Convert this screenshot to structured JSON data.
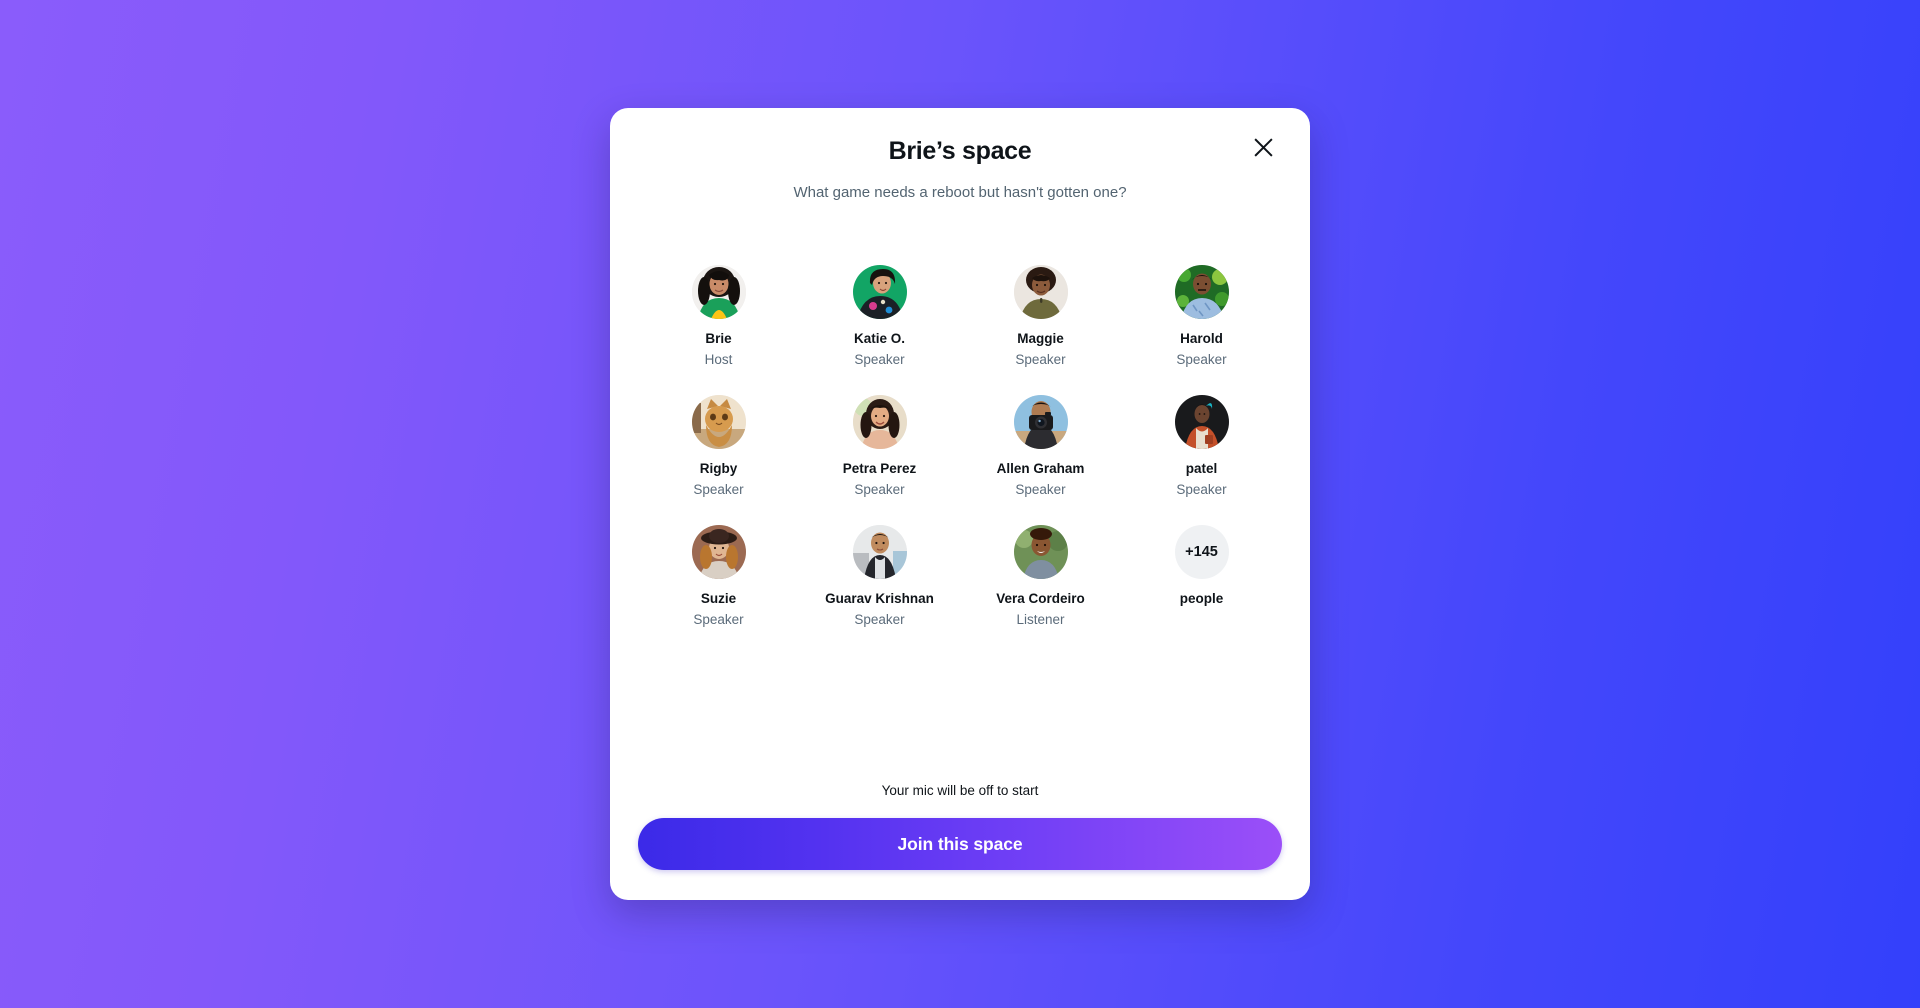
{
  "background": {
    "gradient_from": "#8a5cfb",
    "gradient_to": "#3340fb"
  },
  "modal": {
    "title": "Brie’s space",
    "topic": "What game needs a reboot but hasn't gotten one?",
    "close_icon": "close-icon",
    "close_label": "Close"
  },
  "participants": [
    {
      "name": "Brie",
      "role": "Host",
      "avatar": "woman-green-jacket-yellow-top"
    },
    {
      "name": "Katie O.",
      "role": "Speaker",
      "avatar": "woman-bob-green-background"
    },
    {
      "name": "Maggie",
      "role": "Speaker",
      "avatar": "woman-afro-olive-top"
    },
    {
      "name": "Harold",
      "role": "Speaker",
      "avatar": "man-blue-shirt-foliage"
    },
    {
      "name": "Rigby",
      "role": "Speaker",
      "avatar": "orange-tabby-cat"
    },
    {
      "name": "Petra Perez",
      "role": "Speaker",
      "avatar": "woman-dark-wavy-hair-smiling"
    },
    {
      "name": "Allen Graham",
      "role": "Speaker",
      "avatar": "person-holding-camera"
    },
    {
      "name": "patel",
      "role": "Speaker",
      "avatar": "person-orange-robe-dark-background"
    },
    {
      "name": "Suzie",
      "role": "Speaker",
      "avatar": "woman-wide-brim-hat"
    },
    {
      "name": "Guarav Krishnan",
      "role": "Speaker",
      "avatar": "man-denim-jacket-outdoors"
    },
    {
      "name": "Vera Cordeiro",
      "role": "Listener",
      "avatar": "woman-smiling-green-background"
    }
  ],
  "overflow": {
    "count": "+145",
    "label": "people"
  },
  "footer": {
    "mic_note": "Your mic will be off to start",
    "join_label": "Join this space",
    "join_gradient_from": "#3b2ae8",
    "join_gradient_to": "#9b4ff8"
  }
}
